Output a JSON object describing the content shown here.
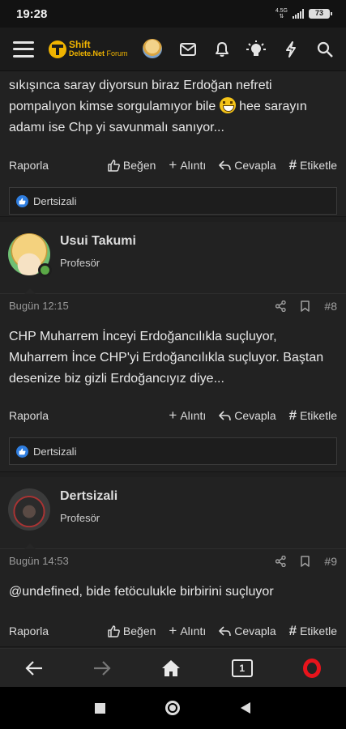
{
  "status": {
    "time": "19:28",
    "network": "4.5G",
    "battery": "73"
  },
  "header": {
    "logo_top": "Shift",
    "logo_delete": "Delete",
    "logo_net": ".Net",
    "logo_forum": "Forum"
  },
  "posts": [
    {
      "text_lines": [
        "sıkışınca saray diyorsun biraz Erdoğan nefreti",
        "pompalıyon kimse sorgulamıyor bile",
        "hee sarayın",
        "adamı ise Chp yi savunmalı sanıyor..."
      ],
      "actions": {
        "report": "Raporla",
        "like": "Beğen",
        "quote": "Alıntı",
        "reply": "Cevapla",
        "tag": "Etiketle"
      },
      "reaction_user": "Dertsizali"
    },
    {
      "author": "Usui Takumi",
      "title": "Profesör",
      "time": "Bugün 12:15",
      "number": "#8",
      "text_lines": [
        "CHP Muharrem İnceyi Erdoğancılıkla suçluyor,",
        "Muharrem İnce CHP'yi Erdoğancılıkla suçluyor. Baştan",
        "desenize biz gizli Erdoğancıyız diye..."
      ],
      "actions": {
        "report": "Raporla",
        "quote": "Alıntı",
        "reply": "Cevapla",
        "tag": "Etiketle"
      },
      "reaction_user": "Dertsizali"
    },
    {
      "author": "Dertsizali",
      "title": "Profesör",
      "time": "Bugün 14:53",
      "number": "#9",
      "text_lines": [
        "@undefined, bide fetöculukle birbirini suçluyor"
      ],
      "actions": {
        "report": "Raporla",
        "like": "Beğen",
        "quote": "Alıntı",
        "reply": "Cevapla",
        "tag": "Etiketle"
      }
    }
  ],
  "browser": {
    "tab_count": "1"
  },
  "colors": {
    "accent": "#f0b400",
    "like": "#2f7ee0",
    "online": "#5aa846",
    "opera": "#e8141c"
  }
}
